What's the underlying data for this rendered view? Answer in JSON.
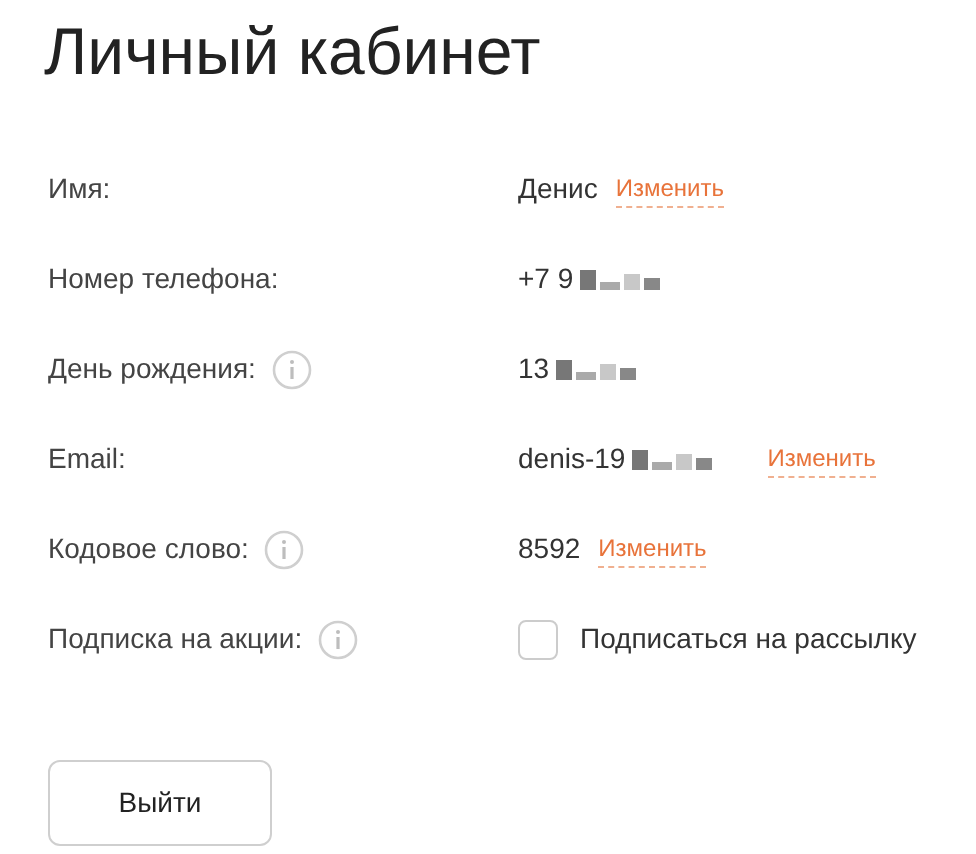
{
  "title": "Личный кабинет",
  "rows": [
    {
      "kind": "text",
      "label": "Имя:",
      "info": false,
      "value": "Денис",
      "redacted": false,
      "action": "Изменить"
    },
    {
      "kind": "text",
      "label": "Номер телефона:",
      "info": false,
      "value": "+7 9",
      "redacted": true
    },
    {
      "kind": "text",
      "label": "День рождения:",
      "info": true,
      "value": "13",
      "redacted": true
    },
    {
      "kind": "text",
      "label": "Email:",
      "info": false,
      "value": "denis-19",
      "redacted": true,
      "action": "Изменить"
    },
    {
      "kind": "text",
      "label": "Кодовое слово:",
      "info": true,
      "value": "8592",
      "redacted": false,
      "action": "Изменить"
    },
    {
      "kind": "checkbox",
      "label": "Подписка на акции:",
      "info": true,
      "value": "Подписаться на рассылку",
      "checked": false
    }
  ],
  "logout": "Выйти"
}
